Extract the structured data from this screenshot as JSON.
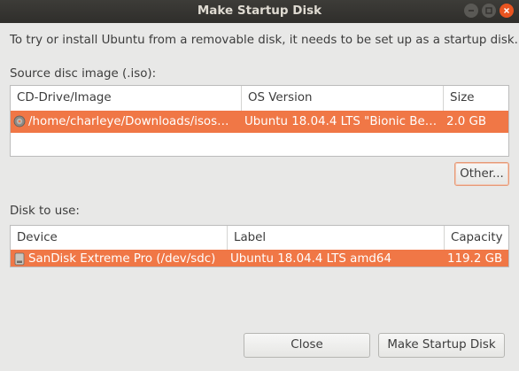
{
  "window": {
    "title": "Make Startup Disk"
  },
  "intro_text": "To try or install Ubuntu from a removable disk, it needs to be set up as a startup disk.",
  "source": {
    "label": "Source disc image (.iso):",
    "columns": [
      "CD-Drive/Image",
      "OS Version",
      "Size"
    ],
    "rows": [
      {
        "image": "/home/charleye/Downloads/isos…",
        "os_version": "Ubuntu 18.04.4 LTS \"Bionic Bea…",
        "size": "2.0 GB",
        "icon": "disc-icon",
        "selected": true
      }
    ],
    "other_button": "Other..."
  },
  "disk": {
    "label": "Disk to use:",
    "columns": [
      "Device",
      "Label",
      "Capacity"
    ],
    "rows": [
      {
        "device": "SanDisk Extreme Pro (/dev/sdc)",
        "label": "Ubuntu 18.04.4 LTS amd64",
        "capacity": "119.2 GB",
        "icon": "usb-drive-icon",
        "selected": true
      }
    ]
  },
  "buttons": {
    "close": "Close",
    "make": "Make Startup Disk"
  },
  "colors": {
    "selection": "#f07746",
    "close_button": "#e95420",
    "titlebar": "#33322f"
  }
}
